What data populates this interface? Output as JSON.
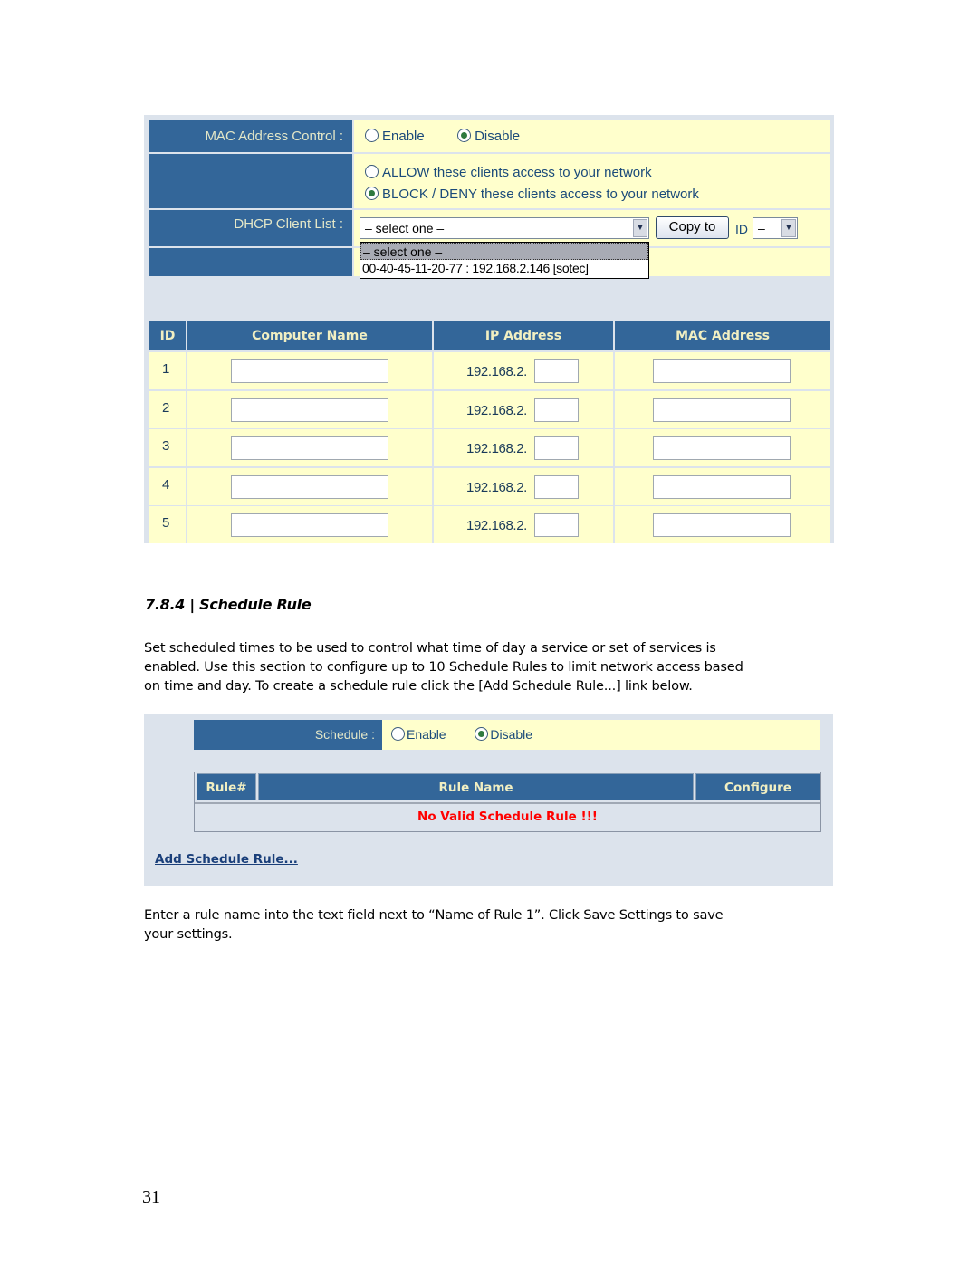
{
  "mac_control": {
    "label": "MAC Address Control :",
    "enable_label": "Enable",
    "disable_label": "Disable",
    "selected": "Disable",
    "allow_label": "ALLOW these clients access to your network",
    "deny_label": "BLOCK / DENY these clients access to your network",
    "access_mode": "deny",
    "dhcp_label": "DHCP Client List :",
    "dhcp_selected": "– select one –",
    "dhcp_options": [
      "– select one –",
      "00-40-45-11-20-77 : 192.168.2.146 [sotec]"
    ],
    "copy_button": "Copy to",
    "id_label": "ID",
    "id_selected": "–"
  },
  "client_table": {
    "headers": [
      "ID",
      "Computer Name",
      "IP Address",
      "MAC Address"
    ],
    "ip_prefix": "192.168.2.",
    "rows": [
      {
        "id": "1",
        "computer_name": "",
        "ip_suffix": "",
        "mac": ""
      },
      {
        "id": "2",
        "computer_name": "",
        "ip_suffix": "",
        "mac": ""
      },
      {
        "id": "3",
        "computer_name": "",
        "ip_suffix": "",
        "mac": ""
      },
      {
        "id": "4",
        "computer_name": "",
        "ip_suffix": "",
        "mac": ""
      },
      {
        "id": "5",
        "computer_name": "",
        "ip_suffix": "",
        "mac": ""
      }
    ]
  },
  "section": {
    "heading": "7.8.4 | Schedule Rule",
    "intro": "Set scheduled times to be used to control what time of day a service or set of services is enabled. Use this section to configure up to 10 Schedule Rules to limit network access based on time and day. To create a schedule rule click the [Add Schedule Rule...] link below.",
    "intro_lines": [
      "Set scheduled times to be used to control what time of day a service or set of services is",
      "enabled. Use this section to configure up to 10 Schedule Rules to limit network access based",
      "on time and day. To create a schedule rule click the [Add Schedule Rule...] link below."
    ],
    "footer_lines": [
      "Enter a rule name into the text field next to “Name of Rule 1”. Click Save Settings to save",
      "your settings."
    ]
  },
  "schedule": {
    "label": "Schedule :",
    "enable_label": "Enable",
    "disable_label": "Disable",
    "selected": "Disable",
    "headers": [
      "Rule#",
      "Rule Name",
      "Configure"
    ],
    "empty_message": "No Valid Schedule Rule !!!",
    "add_link": "Add Schedule Rule...",
    "empty_color": "#ff0000"
  },
  "page_number": "31"
}
